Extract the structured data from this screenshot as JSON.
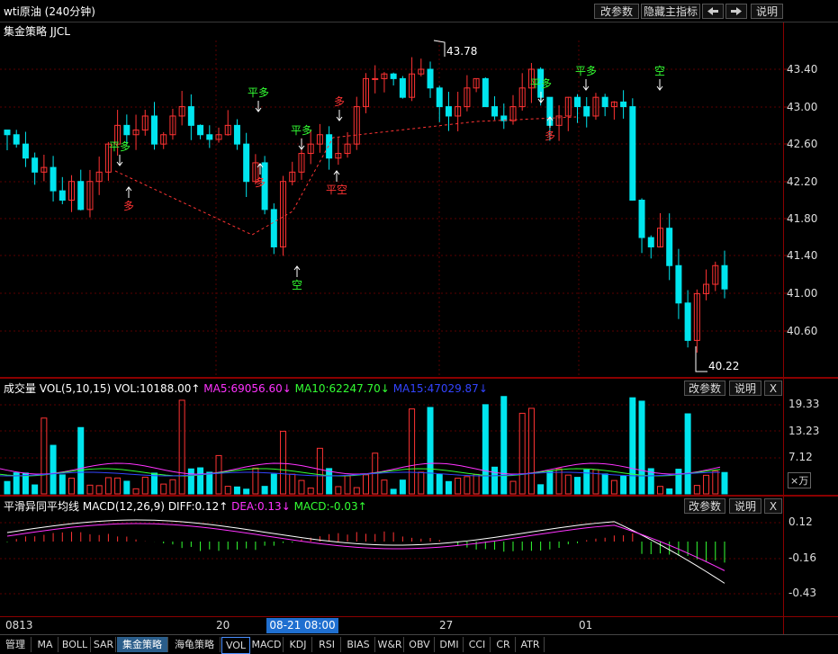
{
  "window": {
    "title": "wti原油 (240分钟)"
  },
  "toolbar": {
    "params": "改参数",
    "hide_indicator": "隐藏主指标",
    "help": "说明",
    "left_arrow": "arrow-left-icon",
    "right_arrow": "arrow-right-icon"
  },
  "main": {
    "strategy_label": "集金策略 JJCL",
    "yaxis": [
      "43.40",
      "43.00",
      "42.60",
      "42.20",
      "41.80",
      "41.40",
      "41.00",
      "40.60"
    ],
    "high_label": "43.78",
    "low_label": "40.22",
    "signals": [
      {
        "text": "平多",
        "color": "#33ff33"
      },
      {
        "text": "多",
        "color": "#ff3333"
      },
      {
        "text": "平多",
        "color": "#33ff33"
      },
      {
        "text": "多",
        "color": "#ff3333"
      },
      {
        "text": "平多",
        "color": "#33ff33"
      },
      {
        "text": "空",
        "color": "#33ff33"
      },
      {
        "text": "多",
        "color": "#ff3333"
      },
      {
        "text": "平空",
        "color": "#ff3333"
      },
      {
        "text": "平多",
        "color": "#33ff33"
      },
      {
        "text": "多",
        "color": "#ff3333"
      },
      {
        "text": "平多",
        "color": "#33ff33"
      },
      {
        "text": "空",
        "color": "#33ff33"
      }
    ]
  },
  "volume": {
    "name": "成交量",
    "params": "VOL(5,10,15)",
    "vol": "VOL:10188.00↑",
    "ma5": "MA5:69056.60↓",
    "ma10": "MA10:62247.70↓",
    "ma15": "MA15:47029.87↓",
    "yaxis": [
      "19.33",
      "13.23",
      "7.12"
    ],
    "unit": "×万",
    "btn_params": "改参数",
    "btn_help": "说明",
    "btn_close": "X"
  },
  "macd": {
    "name": "平滑异同平均线",
    "params": "MACD(12,26,9)",
    "diff": "DIFF:0.12↑",
    "dea": "DEA:0.13↓",
    "macd": "MACD:-0.03↑",
    "yaxis": [
      "0.12",
      "-0.16",
      "-0.43"
    ],
    "btn_params": "改参数",
    "btn_help": "说明",
    "btn_close": "X"
  },
  "timeaxis": {
    "labels": [
      "0813",
      "20",
      "27",
      "01"
    ],
    "cursor": "08-21 08:00"
  },
  "tabs": [
    "管理",
    "MA",
    "BOLL",
    "SAR",
    "集金策略",
    "海龟策略",
    "VOL",
    "MACD",
    "KDJ",
    "RSI",
    "BIAS",
    "W&R",
    "OBV",
    "DMI",
    "CCI",
    "CR",
    "ATR"
  ],
  "colors": {
    "up": "#ff3333",
    "down": "#00e5ee",
    "ma5": "#ff33ff",
    "ma10": "#33ff33",
    "ma15": "#3344ff",
    "grid": "#5a0000"
  }
}
